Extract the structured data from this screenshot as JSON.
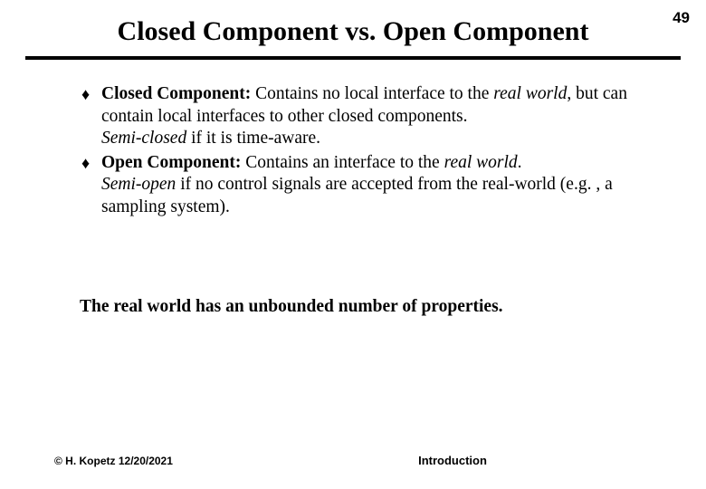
{
  "page_number": "49",
  "title": "Closed Component vs. Open Component",
  "bullets": [
    {
      "lead_bold": "Closed Component:",
      "t1": "  Contains no local interface to the ",
      "i1": "real world",
      "t2": ", but can contain local interfaces to other closed components.",
      "br_i": "Semi-closed",
      "t3": " if it is time-aware."
    },
    {
      "lead_bold": "Open Component:",
      "t1": "  Contains an interface to the ",
      "i1": "real world",
      "t2": ".",
      "br_i": "Semi-open",
      "t3": " if no control signals are accepted from the real-world  (e.g. , a sampling system)."
    }
  ],
  "summary": "The real world has an unbounded number of properties.",
  "footer_left": "© H. Kopetz  12/20/2021",
  "footer_center": "Introduction"
}
